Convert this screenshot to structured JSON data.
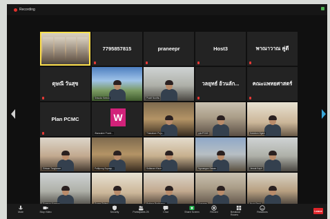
{
  "topbar": {
    "recording_label": "Recording"
  },
  "grid": {
    "tiles": [
      {
        "kind": "video",
        "style": "v-b",
        "active": true,
        "caption": ""
      },
      {
        "kind": "name",
        "label": "7795857815"
      },
      {
        "kind": "name",
        "label": "praneepr"
      },
      {
        "kind": "name",
        "label": "Host3"
      },
      {
        "kind": "name",
        "label": "พาณาวาณ คู่ดี"
      },
      {
        "kind": "name",
        "label": "ดุษณี วันสุข"
      },
      {
        "kind": "video",
        "style": "v-sky",
        "caption": "Srisuda Keeruk"
      },
      {
        "kind": "video",
        "style": "v-g",
        "caption": "Pravit Nunthu"
      },
      {
        "kind": "name",
        "label": "วลยุทธ์ อ้วนลัก..."
      },
      {
        "kind": "name",
        "label": "คณะแพทยศาสตร์"
      },
      {
        "kind": "name",
        "label": "Plan PCMC"
      },
      {
        "kind": "logo",
        "logo": "W",
        "caption": "Wanwalee Promt..."
      },
      {
        "kind": "video",
        "style": "v-f",
        "caption": "Thanakorn Poju..."
      },
      {
        "kind": "video",
        "style": "v-a",
        "caption": "ppicPCMC"
      },
      {
        "kind": "video",
        "style": "v-d",
        "caption": "Kanokon Ngam"
      },
      {
        "kind": "video",
        "style": "v-e",
        "caption": "Siriwan Tongtanee"
      },
      {
        "kind": "video",
        "style": "v-f",
        "caption": "Puttipong Supasp..."
      },
      {
        "kind": "video",
        "style": "v-h",
        "caption": "Suttanan Khum"
      },
      {
        "kind": "video",
        "style": "v-c",
        "caption": "Ngmangan Sawan"
      },
      {
        "kind": "video",
        "style": "v-g",
        "caption": "Jerwat Kaph"
      },
      {
        "kind": "video",
        "style": "v-g",
        "caption": "Sompop Kongpai"
      },
      {
        "kind": "video",
        "style": "v-d",
        "caption": "Sunee Sirilerd"
      },
      {
        "kind": "video",
        "style": "v-e",
        "caption": "Rattana Prathumw..."
      },
      {
        "kind": "video",
        "style": "v-a",
        "caption": "Supunee"
      },
      {
        "kind": "video",
        "style": "v-b",
        "caption": "Nuch Panit"
      }
    ]
  },
  "toolbar": {
    "items": [
      {
        "name": "mute",
        "label": "Mute",
        "icon": "mic-icon"
      },
      {
        "name": "stop-video",
        "label": "Stop Video",
        "icon": "video-icon"
      },
      {
        "name": "security",
        "label": "Security",
        "icon": "shield-icon"
      },
      {
        "name": "participants",
        "label": "Participants",
        "icon": "people-icon",
        "count": "25"
      },
      {
        "name": "chat",
        "label": "Chat",
        "icon": "chat-icon"
      },
      {
        "name": "share-screen",
        "label": "Share Screen",
        "icon": "share-icon"
      },
      {
        "name": "record",
        "label": "Record",
        "icon": "record-icon"
      },
      {
        "name": "breakout-rooms",
        "label": "Breakout Rooms",
        "icon": "grid-icon"
      },
      {
        "name": "reactions",
        "label": "Reactions",
        "icon": "smile-icon"
      }
    ],
    "end_label": "Leave"
  },
  "colors": {
    "accent": "#ffe14d",
    "mic_muted": "#e53935",
    "end_button": "#e0262b",
    "logo_bg": "#d2227a"
  }
}
